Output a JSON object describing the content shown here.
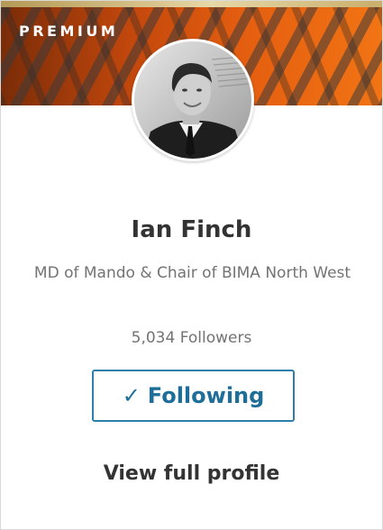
{
  "card": {
    "badge_label": "PREMIUM",
    "name": "Ian Finch",
    "headline": "MD of Mando & Chair of BIMA North West",
    "followers": "5,034 Followers",
    "follow_button": {
      "icon": "check-icon",
      "label": "Following"
    },
    "view_profile_label": "View full profile"
  },
  "colors": {
    "banner_dark": "#7a2c08",
    "banner_orange": "#f27414",
    "gold_strip": "#d8c38c",
    "accent_blue": "#1f6e9a",
    "text_dark": "#333333",
    "text_muted": "#737373"
  }
}
